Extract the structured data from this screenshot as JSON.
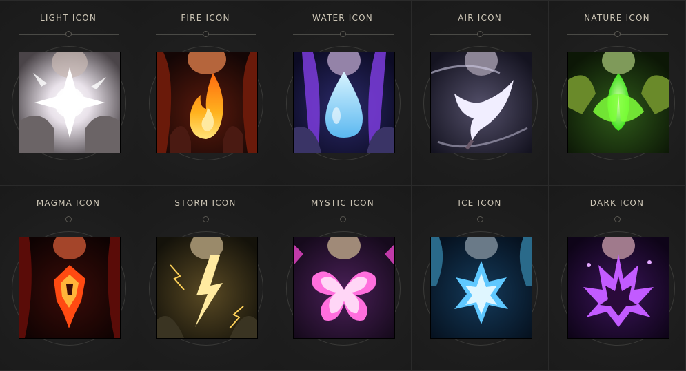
{
  "icons": [
    {
      "title": "LIGHT ICON",
      "icon": "light-icon"
    },
    {
      "title": "FIRE ICON",
      "icon": "fire-icon"
    },
    {
      "title": "WATER ICON",
      "icon": "water-icon"
    },
    {
      "title": "AIR ICON",
      "icon": "air-icon"
    },
    {
      "title": "NATURE ICON",
      "icon": "nature-icon"
    },
    {
      "title": "MAGMA ICON",
      "icon": "magma-icon"
    },
    {
      "title": "STORM ICON",
      "icon": "storm-icon"
    },
    {
      "title": "MYSTIC ICON",
      "icon": "mystic-icon"
    },
    {
      "title": "ICE ICON",
      "icon": "ice-icon"
    },
    {
      "title": "DARK ICON",
      "icon": "dark-icon"
    }
  ],
  "colors": {
    "light": "#ffffff",
    "fire": "#ff9a1a",
    "water": "#8fd8ff",
    "air": "#e9e4ff",
    "nature": "#6dff4a",
    "magma": "#ff4a1a",
    "storm": "#ffe27a",
    "mystic": "#ff8de8",
    "ice": "#6fd0ff",
    "dark": "#c25bff"
  }
}
